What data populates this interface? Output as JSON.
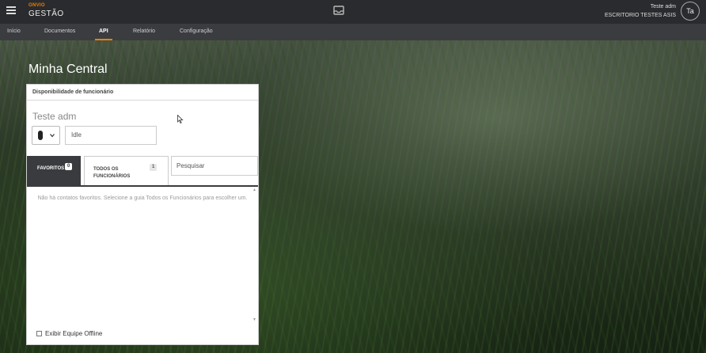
{
  "app": {
    "brand_small": "ONVIO",
    "brand_main": "GESTÃO",
    "user_name": "Teste adm",
    "user_office": "ESCRITORIO TESTES ASIS",
    "avatar_initials": "Ta"
  },
  "nav": {
    "items": [
      {
        "label": "Início"
      },
      {
        "label": "Documentos"
      },
      {
        "label": "API"
      },
      {
        "label": "Relatório"
      },
      {
        "label": "Configuração"
      }
    ],
    "active": "API"
  },
  "page": {
    "title": "Minha Central"
  },
  "panel": {
    "header": "Disponibilidade de funcionário",
    "employee_name": "Teste adm",
    "status_value": "Idle",
    "tabs": {
      "favorites": {
        "label": "FAVORITOS",
        "count": "0"
      },
      "all": {
        "label": "TODOS OS FUNCIONÁRIOS",
        "count": "1"
      }
    },
    "search_placeholder": "Pesquisar",
    "empty_message": "Não há contatos favoritos. Selecione a guia Todos os Funcionários para escolher um.",
    "offline_label": "Exibir Equipe Offline"
  },
  "colors": {
    "accent": "#f07d00",
    "topbar": "#2a2b2e",
    "navbar": "#3b3c40"
  }
}
